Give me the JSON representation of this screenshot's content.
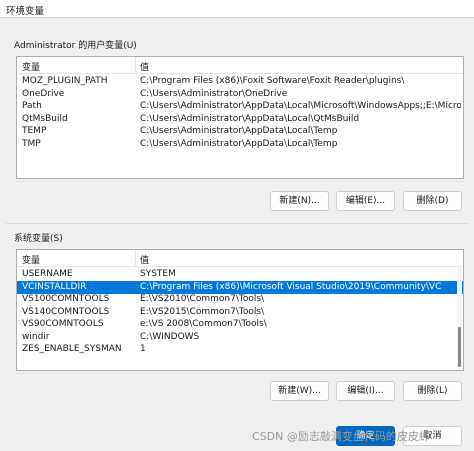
{
  "window": {
    "title": "环境变量"
  },
  "user_vars": {
    "group_label": "Administrator 的用户变量(U)",
    "columns": [
      "变量",
      "值"
    ],
    "rows": [
      [
        "MOZ_PLUGIN_PATH",
        "C:\\Program Files (x86)\\Foxit Software\\Foxit Reader\\plugins\\"
      ],
      [
        "OneDrive",
        "C:\\Users\\Administrator\\OneDrive"
      ],
      [
        "Path",
        "C:\\Users\\Administrator\\AppData\\Local\\Microsoft\\WindowsApps;;E:\\Microsof..."
      ],
      [
        "QtMsBuild",
        "C:\\Users\\Administrator\\AppData\\Local\\QtMsBuild"
      ],
      [
        "TEMP",
        "C:\\Users\\Administrator\\AppData\\Local\\Temp"
      ],
      [
        "TMP",
        "C:\\Users\\Administrator\\AppData\\Local\\Temp"
      ]
    ],
    "buttons": {
      "new": "新建(N)...",
      "edit": "编辑(E)...",
      "delete": "删除(D)"
    }
  },
  "system_vars": {
    "group_label": "系统变量(S)",
    "columns": [
      "变量",
      "值"
    ],
    "rows": [
      [
        "USERNAME",
        "SYSTEM"
      ],
      [
        "VCINSTALLDIR",
        "C:\\Program Files (x86)\\Microsoft Visual Studio\\2019\\Community\\VC"
      ],
      [
        "VS100COMNTOOLS",
        "E:\\VS2010\\Common7\\Tools\\"
      ],
      [
        "VS140COMNTOOLS",
        "E:\\VS2015\\Common7\\Tools\\"
      ],
      [
        "VS90COMNTOOLS",
        "e:\\VS 2008\\Common7\\Tools\\"
      ],
      [
        "windir",
        "C:\\WINDOWS"
      ],
      [
        "ZES_ENABLE_SYSMAN",
        "1"
      ]
    ],
    "selected_row": 1,
    "buttons": {
      "new": "新建(W)...",
      "edit": "编辑(I)...",
      "delete": "删除(L)"
    }
  },
  "footer": {
    "ok": "确定",
    "cancel": "取消"
  },
  "watermark": "CSDN @励志敲满变盘代码的皮皮虾",
  "colors": {
    "selection": "#0078d7",
    "primary_button": "#0067c0"
  }
}
